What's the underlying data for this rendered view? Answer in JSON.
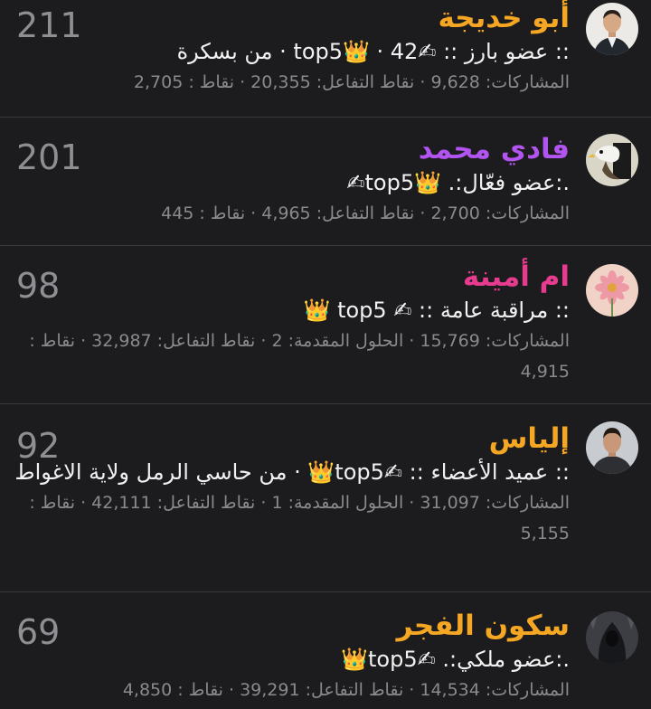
{
  "colors": {
    "background": "#1c1c1e",
    "divider": "#3a3a3c",
    "name_orange": "#f5a623",
    "name_purple": "#b254f0",
    "name_pink": "#e63b8e",
    "score": "#8e8e93",
    "stats": "#8a8a8e"
  },
  "members": [
    {
      "name": "أبو خديجة",
      "name_color": "#f5a623",
      "rank": ":: عضو بارز :: ✍top5👑 · 42 · من بسكرة",
      "stats": "المشاركات: 9,628 · نقاط التفاعل: 20,355 · نقاط : 2,705",
      "score": "211",
      "avatar_icon": "man-in-suit-avatar"
    },
    {
      "name": "فادي محمد",
      "name_color": "#b254f0",
      "rank": ".:عضو فعّال:. 👑top5✍",
      "stats": "المشاركات: 2,700 · نقاط التفاعل: 4,965 · نقاط : 445",
      "score": "201",
      "avatar_icon": "eagle-avatar"
    },
    {
      "name": "ام أمينة",
      "name_color": "#e63b8e",
      "rank": ":: مراقبة عامة :: ✍ top5 👑",
      "stats": "المشاركات: 15,769 · الحلول المقدمة: 2 · نقاط التفاعل: 32,987 · نقاط : 4,915",
      "score": "98",
      "avatar_icon": "pink-flower-avatar"
    },
    {
      "name": "إلياس",
      "name_color": "#f5a623",
      "rank": ":: عميد الأعضاء :: ✍top5👑 · من حاسي الرمل ولاية الاغواط",
      "stats": "المشاركات: 31,097 · الحلول المقدمة: 1 · نقاط التفاعل: 42,111 · نقاط : 5,155",
      "score": "92",
      "avatar_icon": "man-portrait-avatar"
    },
    {
      "name": "سكون الفجر",
      "name_color": "#f5a623",
      "rank": ".:عضو ملكي:. ✍top5👑",
      "stats": "المشاركات: 14,534 · نقاط التفاعل: 39,291 · نقاط : 4,850",
      "score": "69",
      "avatar_icon": "hooded-figure-avatar"
    }
  ]
}
